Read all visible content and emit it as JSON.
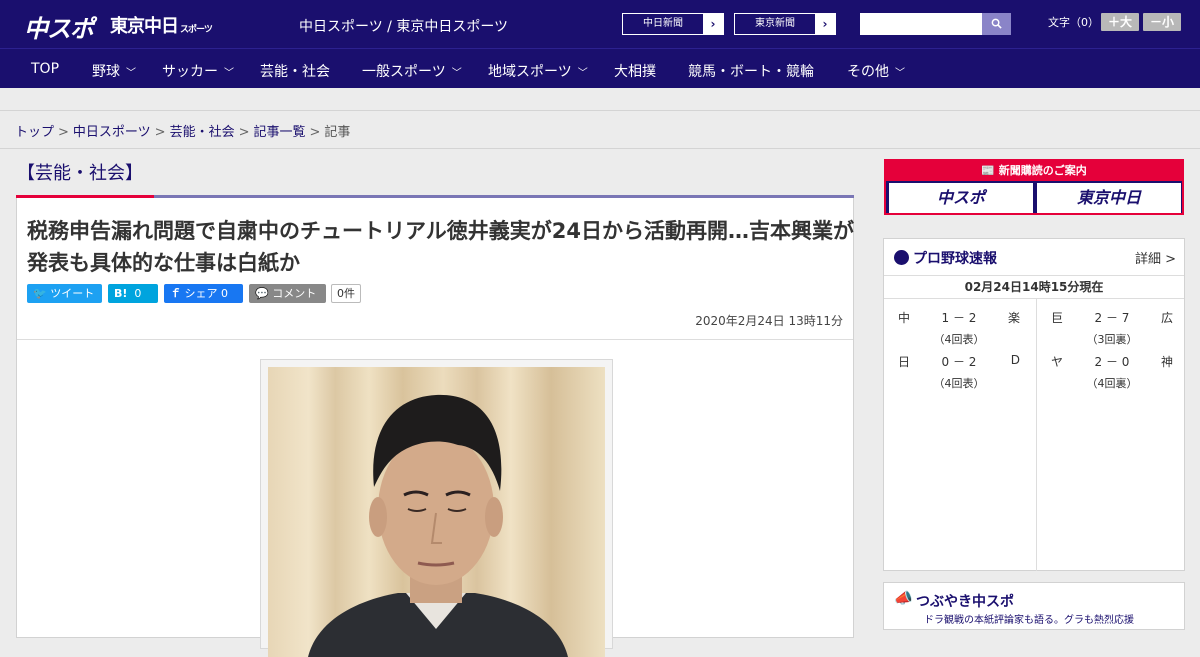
{
  "header": {
    "logo_chuspo": "中スポ",
    "logo_tokyo": "東京中日",
    "logo_tokyo_small": "スポーツ",
    "site_name": "中日スポーツ / 東京中日スポーツ",
    "link_chunichi": "中日新聞",
    "link_tokyo": "東京新聞",
    "search_placeholder": "",
    "font_size_label": "文字（0）",
    "font_bigger": "＋大",
    "font_smaller": "－小"
  },
  "nav": {
    "items": [
      {
        "label": "TOP"
      },
      {
        "label": "野球"
      },
      {
        "label": "サッカー"
      },
      {
        "label": "芸能・社会"
      },
      {
        "label": "一般スポーツ"
      },
      {
        "label": "地域スポーツ"
      },
      {
        "label": "大相撲"
      },
      {
        "label": "競馬・ボート・競輪"
      },
      {
        "label": "その他"
      }
    ]
  },
  "breadcrumb": {
    "items": [
      "トップ",
      "中日スポーツ",
      "芸能・社会",
      "記事一覧"
    ],
    "current": "記事",
    "separator": ">"
  },
  "article": {
    "category": "【芸能・社会】",
    "headline": "税務申告漏れ問題で自粛中のチュートリアル徳井義実が24日から活動再開…吉本興業が発表も具体的な仕事は白紙か",
    "share_twitter": "ツイート",
    "share_hatena": "B!",
    "share_hatena_count": "0",
    "share_facebook": "シェア",
    "share_facebook_count": "0",
    "share_comment": "コメント",
    "comment_count": "0件",
    "date": "2020年2月24日 13時11分"
  },
  "sidebar": {
    "subscription_title": "新聞購読のご案内",
    "subscription_chuspo": "中スポ",
    "subscription_tokyo": "東京中日",
    "baseball": {
      "title": "プロ野球速報",
      "detail": "詳細 >",
      "as_of": "02月24日14時15分現在",
      "games": [
        {
          "home": "中",
          "score": "1 － 2",
          "away": "楽",
          "inning": "（4回表）"
        },
        {
          "home": "日",
          "score": "0 － 2",
          "away": "D",
          "inning": "（4回表）"
        },
        {
          "home": "巨",
          "score": "2 － 7",
          "away": "広",
          "inning": "（3回裏）"
        },
        {
          "home": "ヤ",
          "score": "2 － 0",
          "away": "神",
          "inning": "（4回裏）"
        }
      ]
    },
    "tsubuyaki": {
      "title": "つぶやき中スポ",
      "subtitle": "ドラ観戦の本紙評論家も語る。グラも熱烈応援"
    }
  },
  "colors": {
    "brand_navy": "#1a0f6e",
    "accent_red": "#e5003a",
    "twitter": "#1da1f2",
    "hatena": "#00a4de",
    "facebook": "#1877f2",
    "comment": "#888888"
  }
}
